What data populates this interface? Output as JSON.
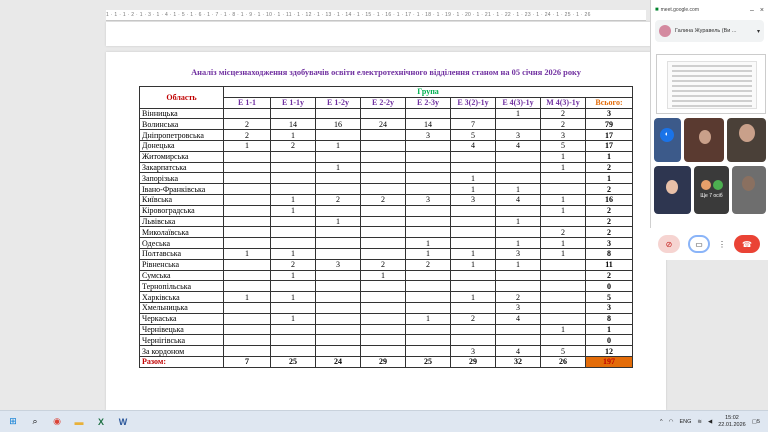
{
  "ruler": {
    "marks": "1 · 1 · 1 · 2 · 1 · 3 · 1 · 4 · 1 · 5 · 1 · 6 · 1 · 7 · 1 · 8 · 1 · 9 · 1 · 10 · 1 · 11 · 1 · 12 · 1 · 13 · 1 · 14 · 1 · 15 · 1 · 16 · 1 · 17 · 1 · 18 · 1 · 19 · 1 · 20 · 1 · 21 · 1 · 22 · 1 · 23 · 1 · 24 · 1 · 25 · 1 · 26"
  },
  "document": {
    "title": "Аналіз місцезнаходження здобувачів освіти електротехнічного відділення станом на 05 січня 2026 року"
  },
  "table": {
    "region_header": "Область",
    "group_header": "Група",
    "columns": [
      "Е 1-1",
      "Е 1-1у",
      "Е 1-2у",
      "Е 2-2у",
      "Е 2-3у",
      "Е 3(2)-1у",
      "Е 4(3)-1у",
      "М 4(3)-1у"
    ],
    "total_header": "Всього:",
    "rows": [
      {
        "region": "Вінницька",
        "v": [
          "",
          "",
          "",
          "",
          "",
          "",
          "1",
          "2"
        ],
        "total": "3"
      },
      {
        "region": "Волинська",
        "v": [
          "2",
          "14",
          "16",
          "24",
          "14",
          "7",
          "",
          "2"
        ],
        "total": "79"
      },
      {
        "region": "Дніпропетровська",
        "v": [
          "2",
          "1",
          "",
          "",
          "3",
          "5",
          "3",
          "3"
        ],
        "total": "17"
      },
      {
        "region": "Донецька",
        "v": [
          "1",
          "2",
          "1",
          "",
          "",
          "4",
          "4",
          "5"
        ],
        "total": "17"
      },
      {
        "region": "Житомирська",
        "v": [
          "",
          "",
          "",
          "",
          "",
          "",
          "",
          "1"
        ],
        "total": "1"
      },
      {
        "region": "Закарпатська",
        "v": [
          "",
          "",
          "1",
          "",
          "",
          "",
          "",
          "1"
        ],
        "total": "2"
      },
      {
        "region": "Запорізька",
        "v": [
          "",
          "",
          "",
          "",
          "",
          "1",
          "",
          ""
        ],
        "total": "1"
      },
      {
        "region": "Івано-Франківська",
        "v": [
          "",
          "",
          "",
          "",
          "",
          "1",
          "1",
          ""
        ],
        "total": "2"
      },
      {
        "region": "Київська",
        "v": [
          "",
          "1",
          "2",
          "2",
          "3",
          "3",
          "4",
          "1"
        ],
        "total": "16"
      },
      {
        "region": "Кіровоградська",
        "v": [
          "",
          "1",
          "",
          "",
          "",
          "",
          "",
          "1"
        ],
        "total": "2"
      },
      {
        "region": "Львівська",
        "v": [
          "",
          "",
          "1",
          "",
          "",
          "",
          "1",
          ""
        ],
        "total": "2"
      },
      {
        "region": "Миколаївська",
        "v": [
          "",
          "",
          "",
          "",
          "",
          "",
          "",
          "2"
        ],
        "total": "2"
      },
      {
        "region": "Одеська",
        "v": [
          "",
          "",
          "",
          "",
          "1",
          "",
          "1",
          "1"
        ],
        "total": "3"
      },
      {
        "region": "Полтавська",
        "v": [
          "1",
          "1",
          "",
          "",
          "1",
          "1",
          "3",
          "1"
        ],
        "total": "8"
      },
      {
        "region": "Рівненська",
        "v": [
          "",
          "2",
          "3",
          "2",
          "2",
          "1",
          "1",
          ""
        ],
        "total": "11"
      },
      {
        "region": "Сумська",
        "v": [
          "",
          "1",
          "",
          "1",
          "",
          "",
          "",
          ""
        ],
        "total": "2"
      },
      {
        "region": "Тернопільська",
        "v": [
          "",
          "",
          "",
          "",
          "",
          "",
          "",
          ""
        ],
        "total": "0"
      },
      {
        "region": "Харківська",
        "v": [
          "1",
          "1",
          "",
          "",
          "",
          "1",
          "2",
          ""
        ],
        "total": "5"
      },
      {
        "region": "Хмельницька",
        "v": [
          "",
          "",
          "",
          "",
          "",
          "",
          "3",
          ""
        ],
        "total": "3"
      },
      {
        "region": "Черкаська",
        "v": [
          "",
          "1",
          "",
          "",
          "1",
          "2",
          "4",
          ""
        ],
        "total": "8"
      },
      {
        "region": "Чернівецька",
        "v": [
          "",
          "",
          "",
          "",
          "",
          "",
          "",
          "1"
        ],
        "total": "1"
      },
      {
        "region": "Чернігівська",
        "v": [
          "",
          "",
          "",
          "",
          "",
          "",
          "",
          ""
        ],
        "total": "0"
      },
      {
        "region": "За кордоном",
        "v": [
          "",
          "",
          "",
          "",
          "",
          "3",
          "4",
          "5"
        ],
        "total": "12"
      }
    ],
    "sum_label": "Разом:",
    "sums": [
      "7",
      "25",
      "24",
      "29",
      "25",
      "29",
      "32",
      "26"
    ],
    "grand_total": "197"
  },
  "meet": {
    "url": "meet.google.com",
    "user_name": "Галина Журавель (Ви ...",
    "others_label": "Ще 7 осіб",
    "mic_muted": true
  },
  "taskbar": {
    "lang": "ENG",
    "time": "15:02",
    "date": "22.01.2026",
    "notifications": "5"
  }
}
